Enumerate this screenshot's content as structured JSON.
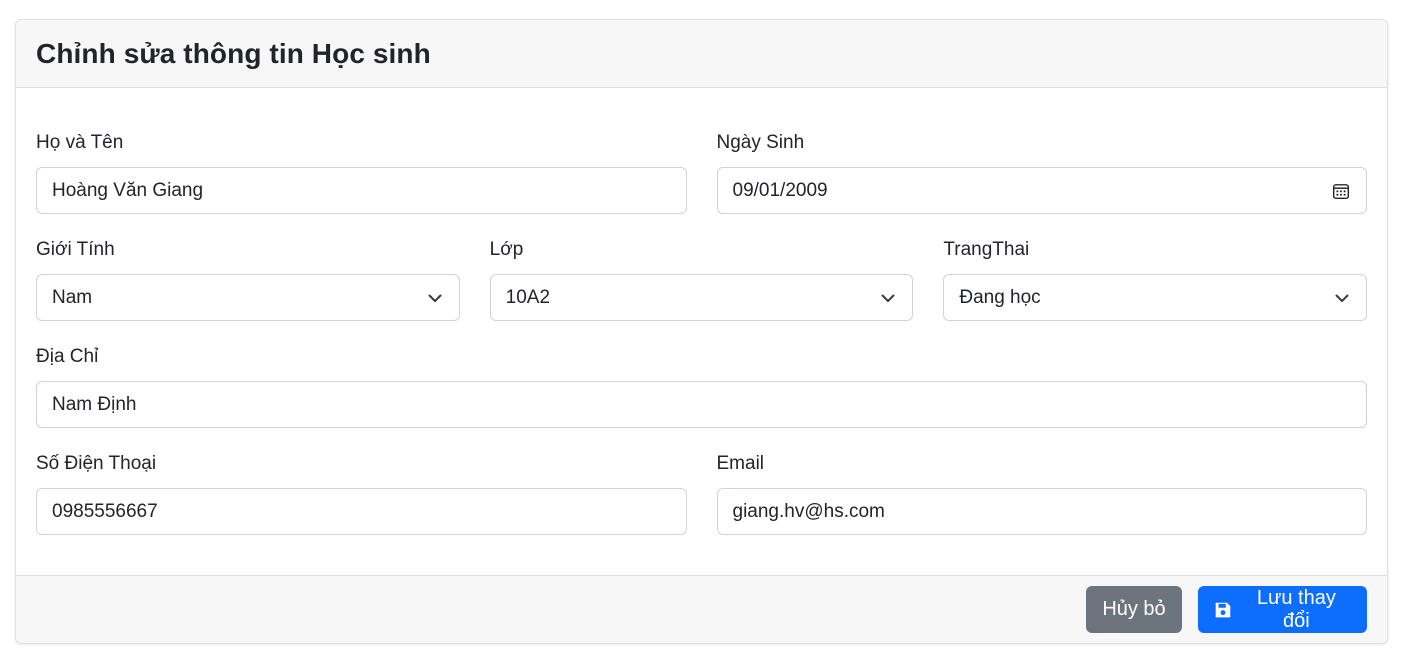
{
  "form": {
    "title": "Chỉnh sửa thông tin Học sinh",
    "fields": {
      "ho_ten": {
        "label": "Họ và Tên",
        "value": "Hoàng Văn Giang"
      },
      "ngay_sinh": {
        "label": "Ngày Sinh",
        "value": "09/01/2009",
        "icon": "calendar-icon"
      },
      "gioi_tinh": {
        "label": "Giới Tính",
        "value": "Nam",
        "icon": "chevron-down-icon"
      },
      "lop": {
        "label": "Lớp",
        "value": "10A2",
        "icon": "chevron-down-icon"
      },
      "trang_thai": {
        "label": "TrangThai",
        "value": "Đang học",
        "icon": "chevron-down-icon"
      },
      "dia_chi": {
        "label": "Địa Chỉ",
        "value": "Nam Định"
      },
      "so_dien_thoai": {
        "label": "Số Điện Thoại",
        "value": "0985556667"
      },
      "email": {
        "label": "Email",
        "value": "giang.hv@hs.com"
      }
    },
    "buttons": {
      "cancel": {
        "label": "Hủy bỏ",
        "color": "#6c757d"
      },
      "save": {
        "label": "Lưu thay đổi",
        "color": "#0d6efd",
        "icon": "floppy-disk-icon"
      }
    }
  }
}
